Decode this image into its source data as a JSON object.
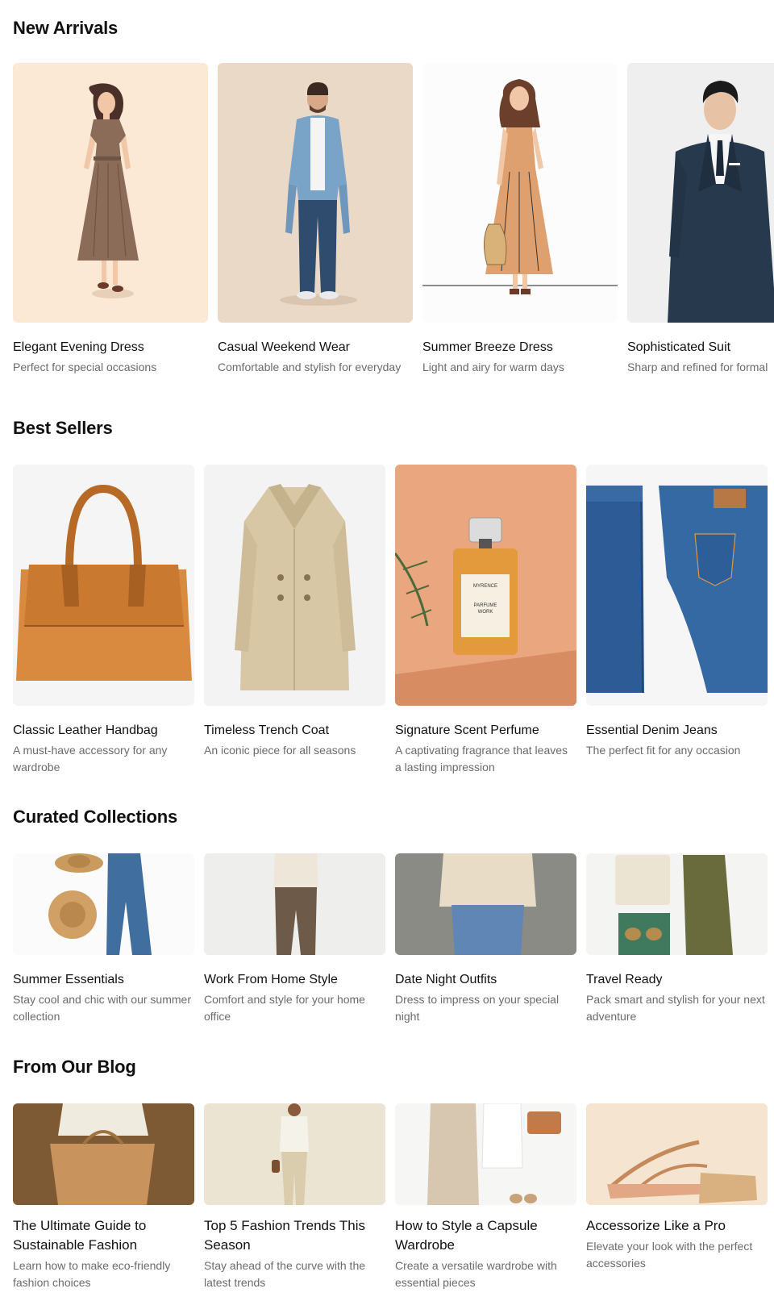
{
  "new_arrivals": {
    "title": "New Arrivals",
    "items": [
      {
        "name": "Elegant Evening Dress",
        "desc": "Perfect for special occasions",
        "image": "woman-brown-dress-illustration"
      },
      {
        "name": "Casual Weekend Wear",
        "desc": "Comfortable and stylish for everyday",
        "image": "man-denim-shirt-jeans"
      },
      {
        "name": "Summer Breeze Dress",
        "desc": "Light and airy for warm days",
        "image": "woman-peach-dress-illustration"
      },
      {
        "name": "Sophisticated Suit",
        "desc": "Sharp and refined for formal",
        "image": "man-navy-suit"
      }
    ]
  },
  "best_sellers": {
    "title": "Best Sellers",
    "items": [
      {
        "name": "Classic Leather Handbag",
        "desc": "A must-have accessory for any wardrobe",
        "image": "tan-leather-handbag"
      },
      {
        "name": "Timeless Trench Coat",
        "desc": "An iconic piece for all seasons",
        "image": "beige-trench-coat"
      },
      {
        "name": "Signature Scent Perfume",
        "desc": "A captivating fragrance that leaves a lasting impression",
        "image": "perfume-bottle",
        "label_text": [
          "MYRENCE",
          "PARFUME",
          "WORK"
        ]
      },
      {
        "name": "Essential Denim Jeans",
        "desc": "The perfect fit for any occasion",
        "image": "folded-denim-jeans"
      }
    ]
  },
  "curated": {
    "title": "Curated Collections",
    "items": [
      {
        "name": "Summer Essentials",
        "desc": "Stay cool and chic with our summer collection",
        "image": "hats-and-jeans-flatlay"
      },
      {
        "name": "Work From Home Style",
        "desc": "Comfort and style for your home office",
        "image": "cream-sweater-brown-trousers"
      },
      {
        "name": "Date Night Outfits",
        "desc": "Dress to impress on your special night",
        "image": "sweater-and-jeans"
      },
      {
        "name": "Travel Ready",
        "desc": "Pack smart and stylish for your next adventure",
        "image": "travel-flatlay"
      }
    ]
  },
  "blog": {
    "title": "From Our Blog",
    "items": [
      {
        "name": "The Ultimate Guide to Sustainable Fashion",
        "desc": "Learn how to make eco-friendly fashion choices",
        "image": "tote-bag-blouse"
      },
      {
        "name": "Top 5 Fashion Trends This Season",
        "desc": "Stay ahead of the curve with the latest trends",
        "image": "woman-neutral-outfit"
      },
      {
        "name": "How to Style a Capsule Wardrobe",
        "desc": "Create a versatile wardrobe with essential pieces",
        "image": "capsule-wardrobe-flatlay"
      },
      {
        "name": "Accessorize Like a Pro",
        "desc": "Elevate your look with the perfect accessories",
        "image": "strappy-sandals"
      }
    ]
  }
}
